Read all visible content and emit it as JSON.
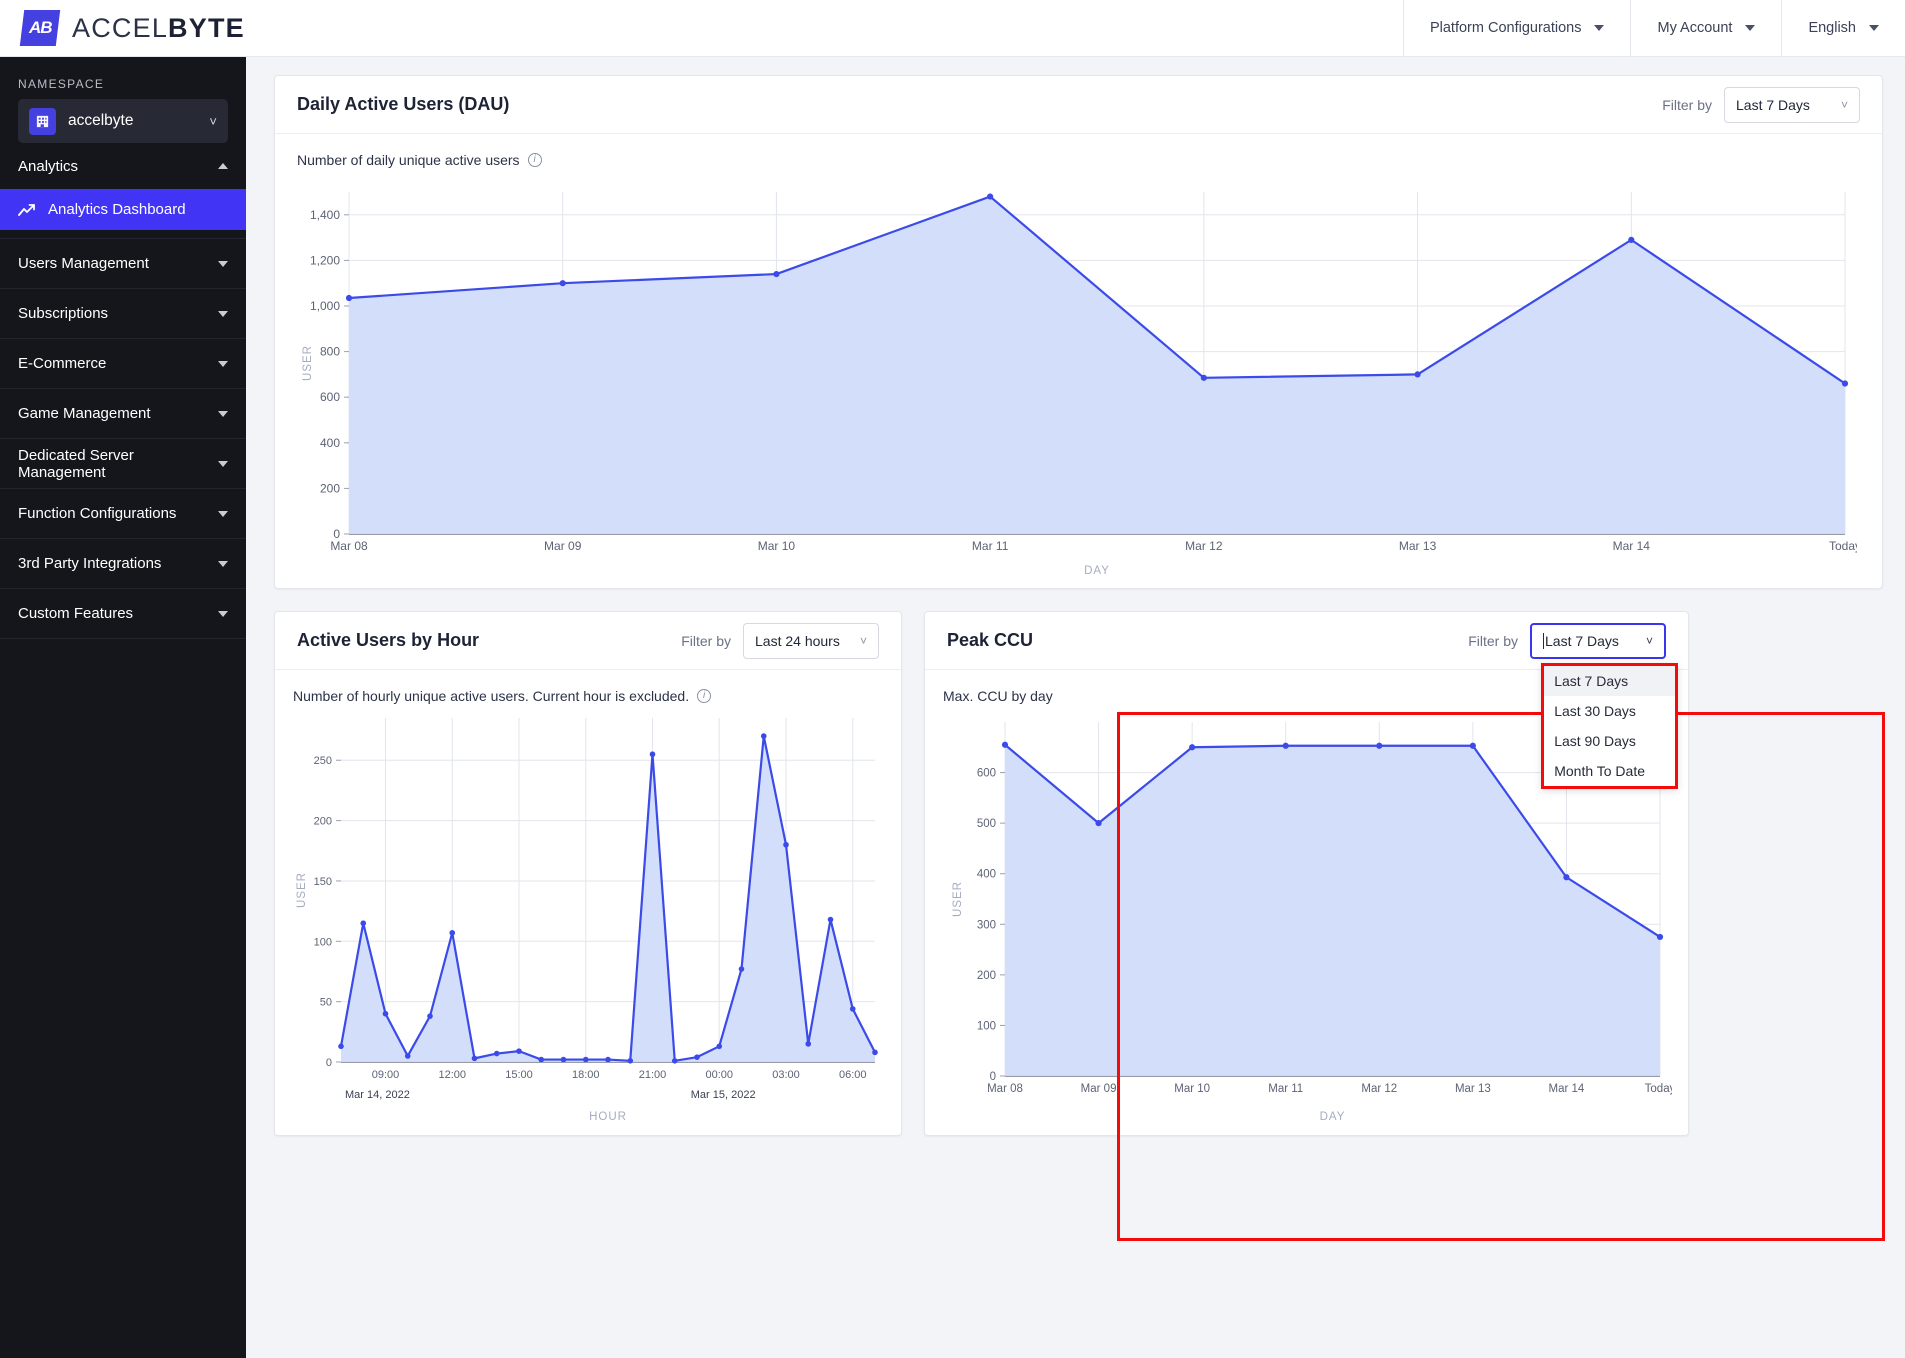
{
  "brand": {
    "name_thin": "ACCEL",
    "name_bold": "BYTE",
    "mark_text": "AB"
  },
  "topnav": [
    {
      "label": "Platform Configurations"
    },
    {
      "label": "My Account"
    },
    {
      "label": "English"
    }
  ],
  "sidebar": {
    "namespace_label": "NAMESPACE",
    "namespace_value": "accelbyte",
    "namespace_icon": "building-icon",
    "section_label": "Analytics",
    "active_item": "Analytics Dashboard",
    "groups": [
      {
        "label": "Users Management"
      },
      {
        "label": "Subscriptions"
      },
      {
        "label": "E-Commerce"
      },
      {
        "label": "Game Management"
      },
      {
        "label": "Dedicated Server Management"
      },
      {
        "label": "Function Configurations"
      },
      {
        "label": "3rd Party Integrations"
      },
      {
        "label": "Custom Features"
      }
    ]
  },
  "dau_card": {
    "title": "Daily Active Users (DAU)",
    "filter_label": "Filter by",
    "filter_value": "Last 7 Days",
    "note": "Number of daily unique active users"
  },
  "hourly_card": {
    "title": "Active Users by Hour",
    "filter_label": "Filter by",
    "filter_value": "Last 24 hours",
    "note": "Number of hourly unique active users. Current hour is excluded."
  },
  "ccu_card": {
    "title": "Peak CCU",
    "filter_label": "Filter by",
    "filter_value": "Last 7 Days",
    "note": "Max. CCU by day",
    "dropdown_open": true,
    "dropdown_options": [
      {
        "label": "Last 7 Days",
        "selected": true
      },
      {
        "label": "Last 30 Days",
        "selected": false
      },
      {
        "label": "Last 90 Days",
        "selected": false
      },
      {
        "label": "Month To Date",
        "selected": false
      }
    ]
  },
  "colors": {
    "accent": "#4134f5",
    "line": "#3b4ae8",
    "area": "#cfdcfa",
    "highlight": "#f40b0b",
    "sidebar_bg": "#14161c"
  },
  "chart_data": [
    {
      "id": "dau",
      "type": "area",
      "title": "Daily Active Users (DAU)",
      "subtitle": "Number of daily unique active users",
      "xlabel": "DAY",
      "ylabel": "USER",
      "categories": [
        "Mar 08",
        "Mar 09",
        "Mar 10",
        "Mar 11",
        "Mar 12",
        "Mar 13",
        "Mar 14",
        "Today"
      ],
      "values": [
        1035,
        1100,
        1140,
        1480,
        685,
        700,
        1290,
        660
      ],
      "ylim": [
        0,
        1500
      ],
      "yticks": [
        0,
        200,
        400,
        600,
        800,
        1000,
        1200,
        1400
      ],
      "ytick_labels": [
        "0",
        "200",
        "400",
        "600",
        "800",
        "1,000",
        "1,200",
        "1,400"
      ],
      "grid": true
    },
    {
      "id": "hourly",
      "type": "area",
      "title": "Active Users by Hour",
      "subtitle": "Number of hourly unique active users. Current hour is excluded.",
      "xlabel": "HOUR",
      "ylabel": "USER",
      "x": [
        "07:00",
        "08:00",
        "09:00",
        "10:00",
        "11:00",
        "12:00",
        "13:00",
        "14:00",
        "15:00",
        "16:00",
        "17:00",
        "18:00",
        "19:00",
        "20:00",
        "21:00",
        "22:00",
        "23:00",
        "00:00",
        "01:00",
        "02:00",
        "03:00",
        "04:00",
        "05:00",
        "06:00",
        "07:00"
      ],
      "xtick_labels": [
        "09:00",
        "12:00",
        "15:00",
        "18:00",
        "21:00",
        "00:00",
        "03:00",
        "06:00"
      ],
      "date_left": "Mar 14, 2022",
      "date_right": "Mar 15, 2022",
      "values": [
        13,
        115,
        40,
        5,
        38,
        107,
        3,
        7,
        9,
        2,
        2,
        2,
        2,
        1,
        255,
        1,
        4,
        13,
        77,
        270,
        180,
        15,
        118,
        44,
        8
      ],
      "ylim": [
        0,
        285
      ],
      "yticks": [
        0,
        50,
        100,
        150,
        200,
        250
      ],
      "ytick_labels": [
        "0",
        "50",
        "100",
        "150",
        "200",
        "250"
      ],
      "grid": true
    },
    {
      "id": "ccu",
      "type": "area",
      "title": "Peak CCU",
      "subtitle": "Max. CCU by day",
      "xlabel": "DAY",
      "ylabel": "USER",
      "categories": [
        "Mar 08",
        "Mar 09",
        "Mar 10",
        "Mar 11",
        "Mar 12",
        "Mar 13",
        "Mar 14",
        "Today"
      ],
      "values": [
        655,
        500,
        650,
        653,
        653,
        653,
        393,
        275
      ],
      "ylim": [
        0,
        700
      ],
      "yticks": [
        0,
        100,
        200,
        300,
        400,
        500,
        600
      ],
      "ytick_labels": [
        "0",
        "100",
        "200",
        "300",
        "400",
        "500",
        "600"
      ],
      "grid": true
    }
  ]
}
